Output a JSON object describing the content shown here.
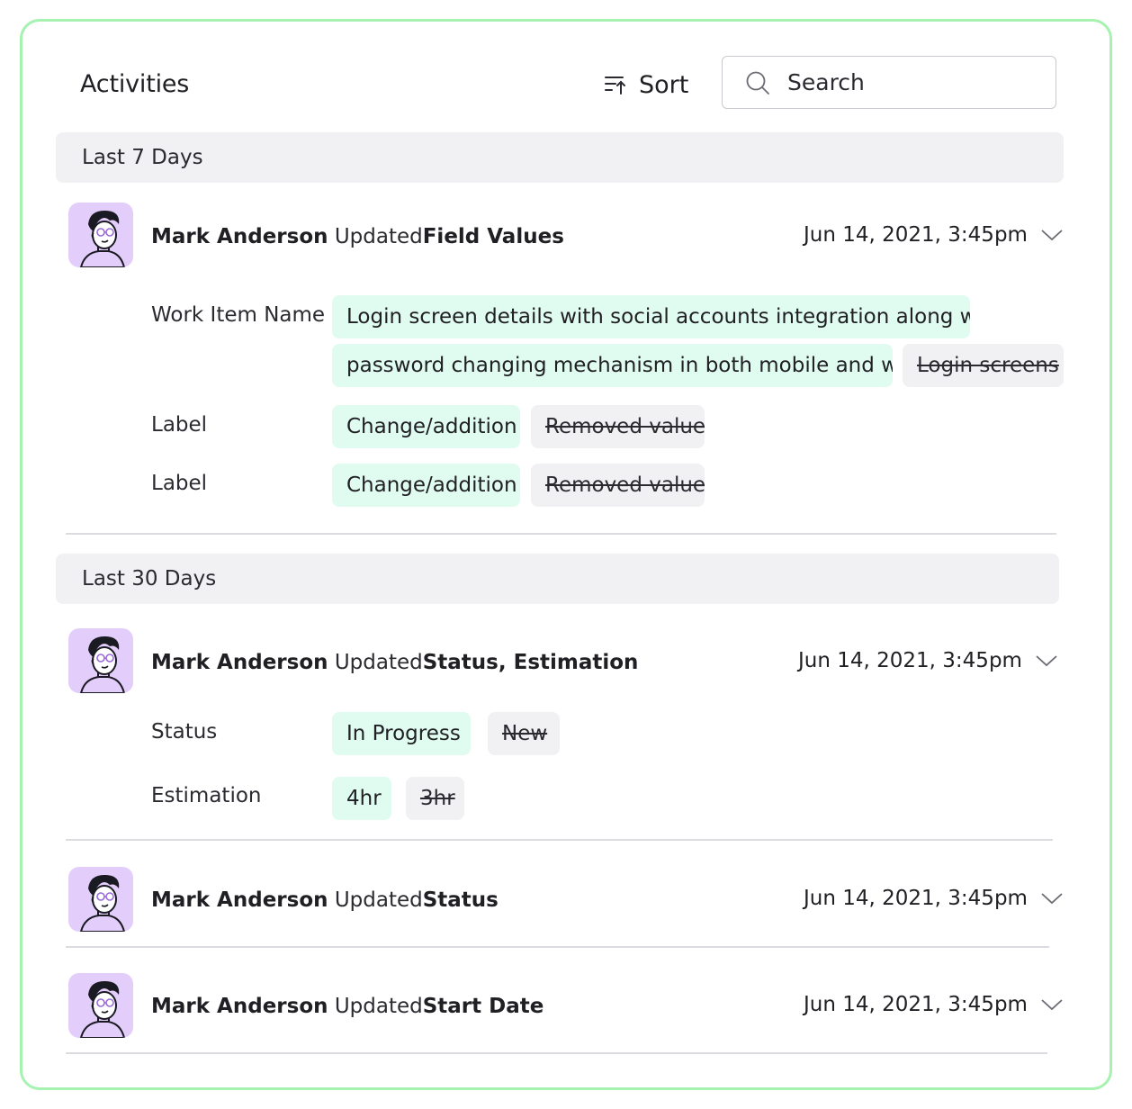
{
  "header": {
    "title": "Activities",
    "sort_label": "Sort",
    "search_placeholder": "Search"
  },
  "groups": [
    {
      "label": "Last 7 Days",
      "activities": [
        {
          "user": "Mark Anderson",
          "verb": "Updated",
          "subject": "Field Values",
          "datetime": "Jun 14, 2021, 3:45pm",
          "fields": [
            {
              "name": "Work Item Name",
              "added_line1": "Login screen details with social accounts integration along with",
              "added_line2": "password changing mechanism in both mobile and web",
              "removed": "Login screens"
            },
            {
              "name": "Label",
              "added": "Change/addition",
              "removed": "Removed value"
            },
            {
              "name": "Label",
              "added": "Change/addition",
              "removed": "Removed value"
            }
          ]
        }
      ]
    },
    {
      "label": "Last 30 Days",
      "activities": [
        {
          "user": "Mark Anderson",
          "verb": "Updated",
          "subject": "Status, Estimation",
          "datetime": "Jun 14, 2021, 3:45pm",
          "fields": [
            {
              "name": "Status",
              "added": "In Progress",
              "removed": "New"
            },
            {
              "name": "Estimation",
              "added": "4hr",
              "removed": "3hr"
            }
          ]
        },
        {
          "user": "Mark Anderson",
          "verb": "Updated",
          "subject": "Status",
          "datetime": "Jun 14, 2021, 3:45pm"
        },
        {
          "user": "Mark Anderson",
          "verb": "Updated",
          "subject": "Start Date",
          "datetime": "Jun 14, 2021, 3:45pm"
        }
      ]
    }
  ],
  "colors": {
    "card_border": "#a6f2b0",
    "added_chip": "#e0fbef",
    "removed_chip": "#f1f1f3",
    "avatar_bg": "#e3cdfb",
    "group_header_bg": "#f1f1f3"
  }
}
